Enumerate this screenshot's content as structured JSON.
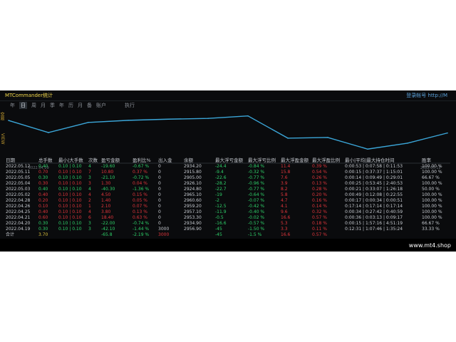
{
  "app": {
    "title": "MTCommander统计",
    "title_right": "登录帐号 http://M",
    "brand": "www.mt4.shop"
  },
  "toolbar": {
    "items": [
      "年",
      "日",
      "周",
      "月",
      "季",
      "年",
      "历",
      "月",
      "备",
      "账户"
    ],
    "selected_index": 1,
    "extra_label": "执行"
  },
  "side_labels": [
    "交易",
    "VIEW"
  ],
  "chart_data": {
    "type": "line",
    "x": [
      "2022.04.19",
      "2022.04.20",
      "2022.04.21",
      "2022.04.25",
      "2022.04.26",
      "2022.04.28",
      "2022.05.02",
      "2022.05.03",
      "2022.05.04",
      "2022.05.05",
      "2022.05.11",
      "2022.05.12"
    ],
    "x_tick_labels": [
      "2022.04.19",
      "2022.05.12"
    ],
    "values": [
      2956.9,
      2934.9,
      2953.3,
      2957.1,
      2959.2,
      2960.6,
      2965.1,
      2924.8,
      2926.1,
      2905.0,
      2915.8,
      2934.2
    ],
    "ylim": [
      2895,
      2975
    ],
    "line_color": "#3ba6d8",
    "grid": false,
    "title": "",
    "xlabel": "",
    "ylabel": ""
  },
  "table": {
    "headers": [
      "日期",
      "总手数",
      "最小|大手数",
      "次数",
      "盈亏金额",
      "盈利比%",
      "出入金",
      "余额",
      "最大浮亏金额",
      "最大浮亏比例",
      "最大浮盈金额",
      "最大浮盈比例",
      "最小|平均|最大持仓时间",
      "胜率"
    ],
    "rows": [
      [
        "2022.05.12",
        "0.40",
        "0.10 | 0.10",
        "4",
        "-19.60",
        "-0.67 %",
        "0",
        "2934.20",
        "-24.4",
        "-0.84 %",
        "11.4",
        "0.39 %",
        "0:00:53 | 0:07:58 | 0:11:53",
        "100.00 %"
      ],
      [
        "2022.05.11",
        "0.70",
        "0.10 | 0.10",
        "7",
        "10.80",
        "0.37 %",
        "0",
        "2915.80",
        "-9.4",
        "-0.32 %",
        "15.8",
        "0.54 %",
        "0:00:15 | 0:37:37 | 1:15:01",
        "100.00 %"
      ],
      [
        "2022.05.05",
        "0.30",
        "0.10 | 0.10",
        "3",
        "-21.10",
        "-0.72 %",
        "0",
        "2905.00",
        "-22.6",
        "-0.77 %",
        "7.6",
        "0.26 %",
        "0:00:14 | 0:09:49 | 0:29:01",
        "66.67 %"
      ],
      [
        "2022.05.04",
        "0.30",
        "0.10 | 0.10",
        "3",
        "1.30",
        "0.04 %",
        "0",
        "2926.10",
        "-28.2",
        "-0.96 %",
        "3.9",
        "0.13 %",
        "0:00:25 | 0:53:45 | 2:40:53",
        "100.00 %"
      ],
      [
        "2022.05.03",
        "0.40",
        "0.10 | 0.10",
        "4",
        "-40.30",
        "-1.36 %",
        "0",
        "2924.80",
        "-22.7",
        "-0.77 %",
        "8.2",
        "0.28 %",
        "0:00:21 | 0:33:07 | 1:26:18",
        "50.00 %"
      ],
      [
        "2022.05.02",
        "0.40",
        "0.10 | 0.10",
        "4",
        "4.50",
        "0.15 %",
        "0",
        "2965.10",
        "-19",
        "-0.64 %",
        "5.8",
        "0.20 %",
        "0:00:49 | 0:12:08 | 0:22:55",
        "100.00 %"
      ],
      [
        "2022.04.28",
        "0.20",
        "0.10 | 0.10",
        "2",
        "1.40",
        "0.05 %",
        "0",
        "2960.60",
        "-2",
        "-0.07 %",
        "4.7",
        "0.16 %",
        "0:00:17 | 0:00:34 | 0:00:51",
        "100.00 %"
      ],
      [
        "2022.04.26",
        "0.10",
        "0.10 | 0.10",
        "1",
        "2.10",
        "0.07 %",
        "0",
        "2959.20",
        "-12.5",
        "-0.42 %",
        "4.1",
        "0.14 %",
        "0:17:14 | 0:17:14 | 0:17:14",
        "100.00 %"
      ],
      [
        "2022.04.25",
        "0.40",
        "0.10 | 0.10",
        "4",
        "3.80",
        "0.13 %",
        "0",
        "2957.10",
        "-11.9",
        "-0.40 %",
        "9.6",
        "0.32 %",
        "0:00:34 | 0:27:42 | 0:40:59",
        "100.00 %"
      ],
      [
        "2022.04.21",
        "0.60",
        "0.10 | 0.10",
        "6",
        "18.40",
        "0.63 %",
        "0",
        "2953.30",
        "-0.5",
        "-0.02 %",
        "16.6",
        "0.57 %",
        "0:00:36 | 0:03:13 | 0:09:17",
        "100.00 %"
      ],
      [
        "2022.04.20",
        "0.30",
        "0.10 | 0.10",
        "3",
        "-22.00",
        "-0.74 %",
        "0",
        "2934.90",
        "-16.6",
        "-0.57 %",
        "5.3",
        "0.18 %",
        "0:00:15 | 1:57:16 | 4:51:19",
        "66.67 %"
      ],
      [
        "2022.04.19",
        "0.30",
        "0.10 | 0.10",
        "3",
        "-42.10",
        "-1.44 %",
        "3000",
        "2956.90",
        "-45",
        "-1.50 %",
        "3.3",
        "0.11 %",
        "0:12:31 | 1:07:46 | 1:35:24",
        "33.33 %"
      ]
    ],
    "total": [
      "合计",
      "3.70",
      "",
      "",
      "-65.8",
      "-2.19 %",
      "3000",
      "",
      "-45",
      "-1.5 %",
      "16.6",
      "0.57 %",
      "",
      ""
    ]
  },
  "colors": {
    "background": "#0a0b0d",
    "positive": "#2fd26a",
    "negative": "#e2363c",
    "neutral": "#c8ccd2",
    "title": "#f0d64a"
  }
}
